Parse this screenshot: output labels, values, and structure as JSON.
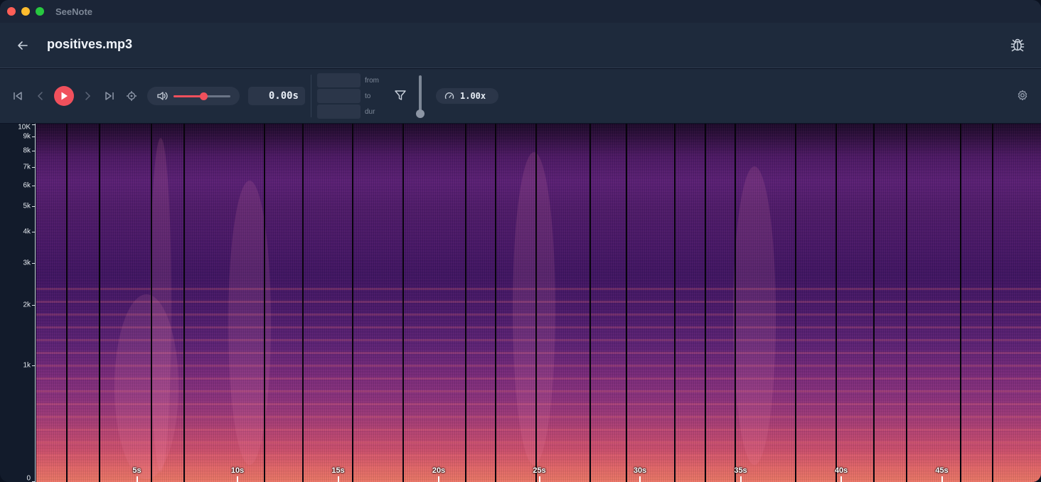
{
  "window": {
    "app_title": "SeeNote"
  },
  "header": {
    "file_name": "positives.mp3",
    "back_icon": "arrow-left-icon",
    "debug_icon": "bug-icon"
  },
  "toolbar": {
    "skip_start_icon": "skip-to-start-icon",
    "prev_icon": "chevron-left-icon",
    "play_icon": "play-icon",
    "next_icon": "chevron-right-icon",
    "skip_end_icon": "skip-to-end-icon",
    "locate_icon": "crosshair-icon",
    "volume_icon": "speaker-icon",
    "volume_level": 0.52,
    "time_display": "0.00s",
    "range": {
      "from_label": "from",
      "to_label": "to",
      "dur_label": "dur",
      "from_value": "",
      "to_value": "",
      "dur_value": ""
    },
    "filter_icon": "filter-icon",
    "gain_level": 0.0,
    "speed_icon": "gauge-icon",
    "speed": "1.00x",
    "settings_icon": "gear-icon"
  },
  "spectrogram": {
    "y_axis": [
      {
        "label": "10K",
        "hz": 10000
      },
      {
        "label": "9k",
        "hz": 9000
      },
      {
        "label": "8k",
        "hz": 8000
      },
      {
        "label": "7k",
        "hz": 7000
      },
      {
        "label": "6k",
        "hz": 6000
      },
      {
        "label": "5k",
        "hz": 5000
      },
      {
        "label": "4k",
        "hz": 4000
      },
      {
        "label": "3k",
        "hz": 3000
      },
      {
        "label": "2k",
        "hz": 2000
      },
      {
        "label": "1k",
        "hz": 1000
      },
      {
        "label": "0",
        "hz": 0
      }
    ],
    "x_axis": [
      {
        "label": "5s",
        "sec": 5
      },
      {
        "label": "10s",
        "sec": 10
      },
      {
        "label": "15s",
        "sec": 15
      },
      {
        "label": "20s",
        "sec": 20
      },
      {
        "label": "25s",
        "sec": 25
      },
      {
        "label": "30s",
        "sec": 30
      },
      {
        "label": "35s",
        "sec": 35
      },
      {
        "label": "40s",
        "sec": 40
      },
      {
        "label": "45s",
        "sec": 45
      }
    ],
    "segment_boundaries_sec": [
      1.5,
      3.1,
      5.7,
      7.3,
      11.3,
      13.2,
      15.7,
      18.2,
      21.3,
      22.8,
      24.8,
      27.5,
      29.3,
      31.7,
      33.2,
      34.7,
      37.7,
      39.7,
      41.6,
      43.2,
      45.9,
      47.5
    ]
  },
  "colors": {
    "accent": "#f0505c",
    "toolbar_bg": "#1e2a3c",
    "titlebar_bg": "#1b2537"
  }
}
